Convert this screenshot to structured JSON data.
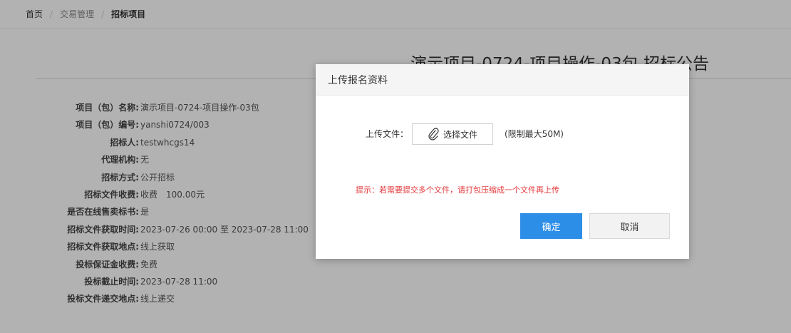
{
  "breadcrumb": {
    "home": "首页",
    "separator": "/",
    "level1": "交易管理",
    "current": "招标项目"
  },
  "announcement": {
    "title": "演示项目-0724-项目操作-03包 招标公告",
    "fields": [
      {
        "label": "项目（包）名称:",
        "value": "演示项目-0724-项目操作-03包"
      },
      {
        "label": "项目（包）编号:",
        "value": "yanshi0724/003"
      },
      {
        "label": "招标人:",
        "value": "testwhcgs14"
      },
      {
        "label": "代理机构:",
        "value": "无"
      },
      {
        "label": "招标方式:",
        "value": "公开招标"
      },
      {
        "label": "招标文件收费:",
        "value": "收费　100.00元"
      },
      {
        "label": "是否在线售卖标书:",
        "value": "是"
      },
      {
        "label": "招标文件获取时间:",
        "value": "2023-07-26 00:00 至 2023-07-28 11:00"
      },
      {
        "label": "招标文件获取地点:",
        "value": "线上获取"
      },
      {
        "label": "投标保证金收费:",
        "value": "免费"
      },
      {
        "label": "投标截止时间:",
        "value": "2023-07-28 11:00"
      },
      {
        "label": "投标文件递交地点:",
        "value": "线上递交"
      }
    ]
  },
  "modal": {
    "title": "上传报名资料",
    "upload_label": "上传文件：",
    "choose_file": "选择文件",
    "choose_icon": "paperclip-icon",
    "limit": "(限制最大50M)",
    "hint": "提示：若需要提交多个文件，请打包压缩成一个文件再上传",
    "ok": "确定",
    "cancel": "取消"
  },
  "colors": {
    "primary": "#2d8ee8",
    "hint": "#e3393c",
    "overlay": "rgba(0,0,0,0.30)"
  }
}
